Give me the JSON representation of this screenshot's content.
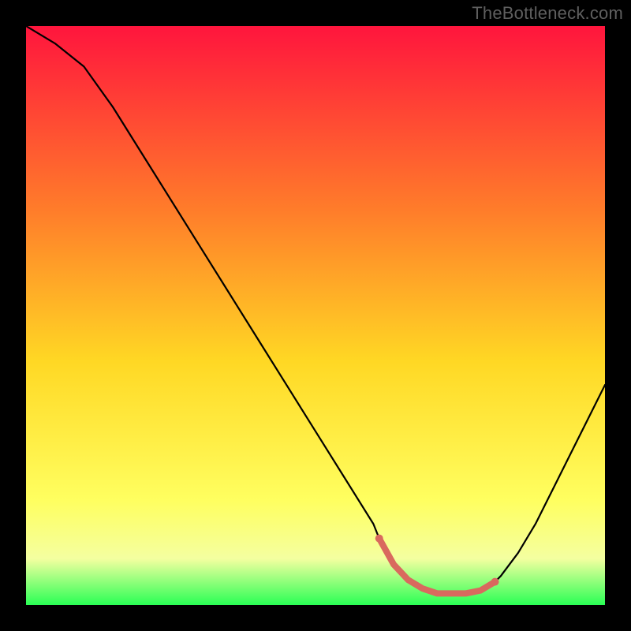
{
  "watermark": "TheBottleneck.com",
  "chart_data": {
    "type": "line",
    "title": "",
    "xlabel": "",
    "ylabel": "",
    "xlim": [
      0,
      100
    ],
    "ylim": [
      0,
      100
    ],
    "grid": false,
    "legend": false,
    "background": {
      "gradient_top": "#ff153d",
      "gradient_mid_upper": "#ff7d2a",
      "gradient_mid": "#ffd824",
      "gradient_low": "#ffff60",
      "gradient_bottom": "#2aff55"
    },
    "annotations": {
      "minimum_band_color": "#d9695e",
      "minimum_band_x_range": [
        61,
        81
      ]
    },
    "series": [
      {
        "name": "bottleneck-curve",
        "color": "#000000",
        "x": [
          0,
          5,
          10,
          15,
          20,
          25,
          30,
          35,
          40,
          45,
          50,
          55,
          60,
          62,
          65,
          68,
          71,
          74,
          77,
          80,
          82,
          85,
          88,
          91,
          94,
          97,
          100
        ],
        "y": [
          100,
          97,
          93,
          86,
          78,
          70,
          62,
          54,
          46,
          38,
          30,
          22,
          14,
          9,
          5,
          3,
          2,
          2,
          2,
          3,
          5,
          9,
          14,
          20,
          26,
          32,
          38
        ]
      }
    ]
  }
}
